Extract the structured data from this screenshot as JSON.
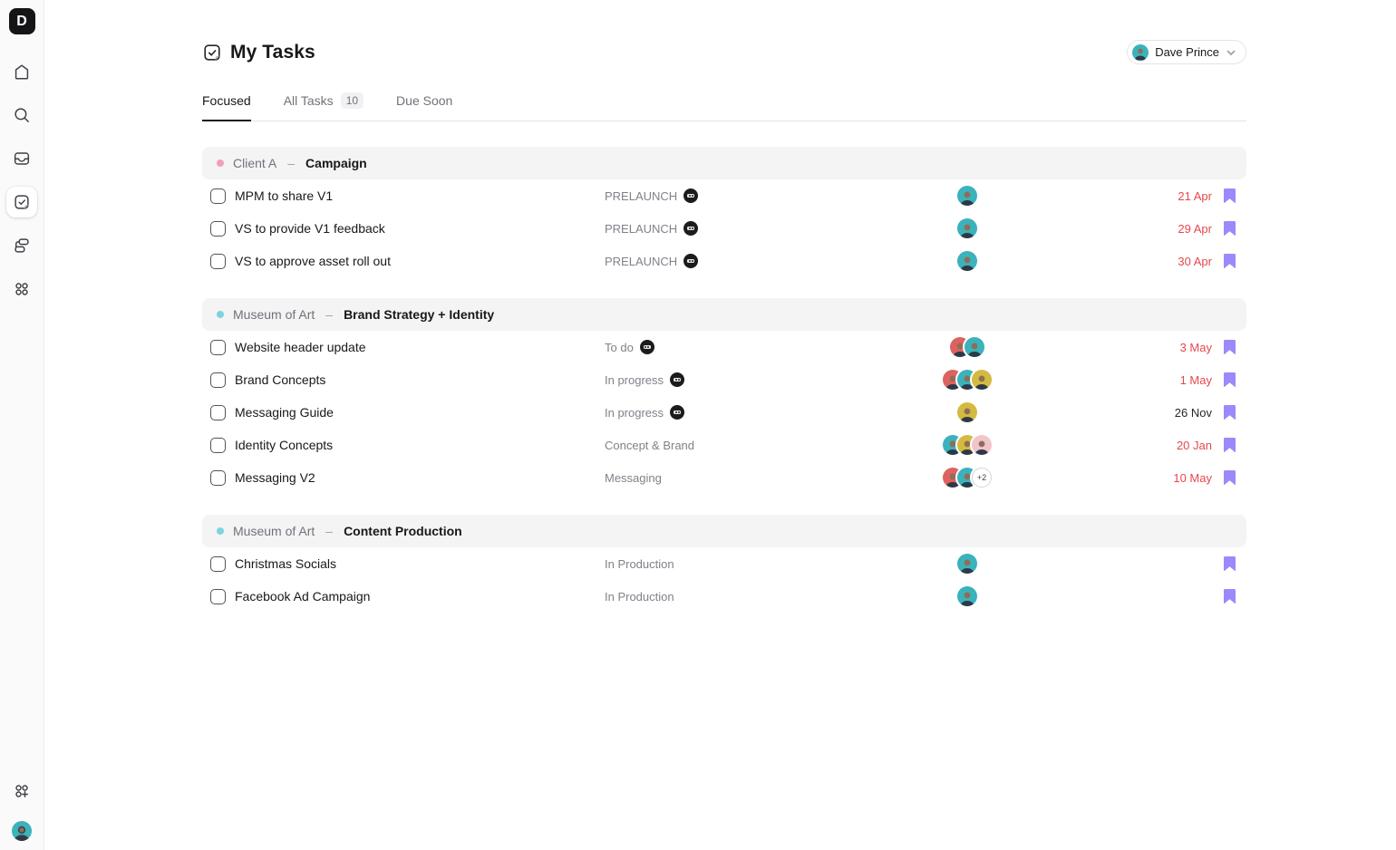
{
  "app": {
    "logo_letter": "D",
    "accent_colors": {
      "overdue_red": "#e5484d",
      "bookmark_purple": "#9b8afb",
      "section_bg": "#f4f4f5",
      "status_gray": "#81818a"
    }
  },
  "sidebar": {
    "nav_icons": [
      "home-icon",
      "search-icon",
      "inbox-icon",
      "tasks-icon",
      "projects-icon",
      "apps-icon"
    ],
    "active_item": "tasks",
    "bottom_icons": [
      "add-apps-icon",
      "user-avatar"
    ]
  },
  "header": {
    "title": "My Tasks",
    "user_button": {
      "name": "Dave Prince",
      "avatar_color": "teal",
      "chevron": "chevron-down-icon"
    }
  },
  "tabs": [
    {
      "label": "Focused",
      "active": true
    },
    {
      "label": "All Tasks",
      "badge": "10",
      "active": false
    },
    {
      "label": "Due Soon",
      "active": false
    }
  ],
  "avatar_palette": {
    "teal": "#3cb2bb",
    "red": "#dd6260",
    "yellow": "#d4ba40",
    "pink": "#f0c6cb"
  },
  "sections": [
    {
      "client": "Client A",
      "separator": "–",
      "project": "Campaign",
      "dot_color": "#f0a0b4",
      "tasks": [
        {
          "title": "MPM to share V1",
          "status": "PRELAUNCH",
          "status_logo": true,
          "assignees": [
            "teal"
          ],
          "due": "21 Apr",
          "overdue": true,
          "bookmarked": true
        },
        {
          "title": "VS to provide V1 feedback",
          "status": "PRELAUNCH",
          "status_logo": true,
          "assignees": [
            "teal"
          ],
          "due": "29 Apr",
          "overdue": true,
          "bookmarked": true
        },
        {
          "title": "VS to approve asset roll out",
          "status": "PRELAUNCH",
          "status_logo": true,
          "assignees": [
            "teal"
          ],
          "due": "30 Apr",
          "overdue": true,
          "bookmarked": true
        }
      ]
    },
    {
      "client": "Museum of Art",
      "separator": "–",
      "project": "Brand Strategy + Identity",
      "dot_color": "#7cd4de",
      "tasks": [
        {
          "title": "Website header update",
          "status": "To do",
          "status_logo": true,
          "assignees": [
            "red",
            "teal"
          ],
          "due": "3 May",
          "overdue": true,
          "bookmarked": true
        },
        {
          "title": "Brand Concepts",
          "status": "In progress",
          "status_logo": true,
          "assignees": [
            "red",
            "teal",
            "yellow"
          ],
          "due": "1 May",
          "overdue": true,
          "bookmarked": true
        },
        {
          "title": "Messaging Guide",
          "status": "In progress",
          "status_logo": true,
          "assignees": [
            "yellow"
          ],
          "due": "26 Nov",
          "overdue": false,
          "bookmarked": true
        },
        {
          "title": "Identity Concepts",
          "status": "Concept & Brand",
          "status_logo": false,
          "assignees": [
            "teal",
            "yellow",
            "pink"
          ],
          "due": "20 Jan",
          "overdue": true,
          "bookmarked": true
        },
        {
          "title": "Messaging V2",
          "status": "Messaging",
          "status_logo": false,
          "assignees": [
            "red",
            "teal",
            {
              "overflow": "+2"
            }
          ],
          "due": "10 May",
          "overdue": true,
          "bookmarked": true
        }
      ]
    },
    {
      "client": "Museum of Art",
      "separator": "–",
      "project": "Content Production",
      "dot_color": "#7cd4de",
      "tasks": [
        {
          "title": "Christmas Socials",
          "status": "In Production",
          "status_logo": false,
          "assignees": [
            "teal"
          ],
          "due": "",
          "overdue": false,
          "bookmarked": true
        },
        {
          "title": "Facebook Ad Campaign",
          "status": "In Production",
          "status_logo": false,
          "assignees": [
            "teal"
          ],
          "due": "",
          "overdue": false,
          "bookmarked": true
        }
      ]
    }
  ]
}
